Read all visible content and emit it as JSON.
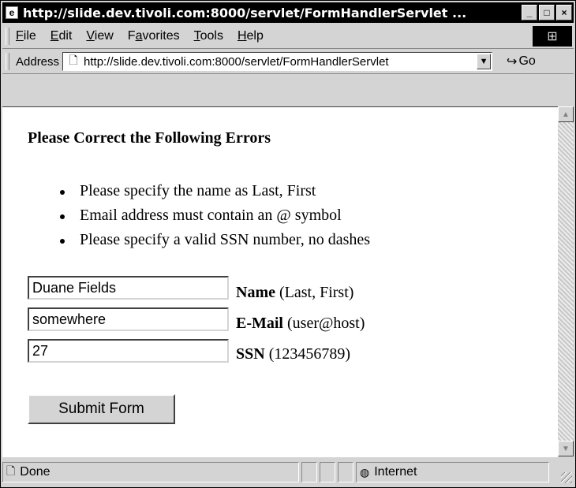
{
  "window": {
    "title": "http://slide.dev.tivoli.com:8000/servlet/FormHandlerServlet ...",
    "minimize_glyph": "_",
    "maximize_glyph": "□",
    "close_glyph": "×"
  },
  "menu": {
    "items": [
      {
        "label": "File",
        "accel": "F"
      },
      {
        "label": "Edit",
        "accel": "E"
      },
      {
        "label": "View",
        "accel": "V"
      },
      {
        "label": "Favorites",
        "accel": "a"
      },
      {
        "label": "Tools",
        "accel": "T"
      },
      {
        "label": "Help",
        "accel": "H"
      }
    ]
  },
  "address": {
    "label": "Address",
    "url": "http://slide.dev.tivoli.com:8000/servlet/FormHandlerServlet",
    "go_label": "Go"
  },
  "page": {
    "heading": "Please Correct the Following Errors",
    "errors": [
      "Please specify the name as Last, First",
      "Email address must contain an @ symbol",
      "Please specify a valid SSN number, no dashes"
    ],
    "fields": {
      "name": {
        "value": "Duane Fields",
        "label": "Name",
        "hint": "(Last, First)"
      },
      "email": {
        "value": "somewhere",
        "label": "E-Mail",
        "hint": "(user@host)"
      },
      "ssn": {
        "value": "27",
        "label": "SSN",
        "hint": "(123456789)"
      }
    },
    "submit_label": "Submit Form"
  },
  "status": {
    "text": "Done",
    "zone": "Internet"
  },
  "icons": {
    "page": "ie-page-icon",
    "globe": "globe-icon"
  }
}
